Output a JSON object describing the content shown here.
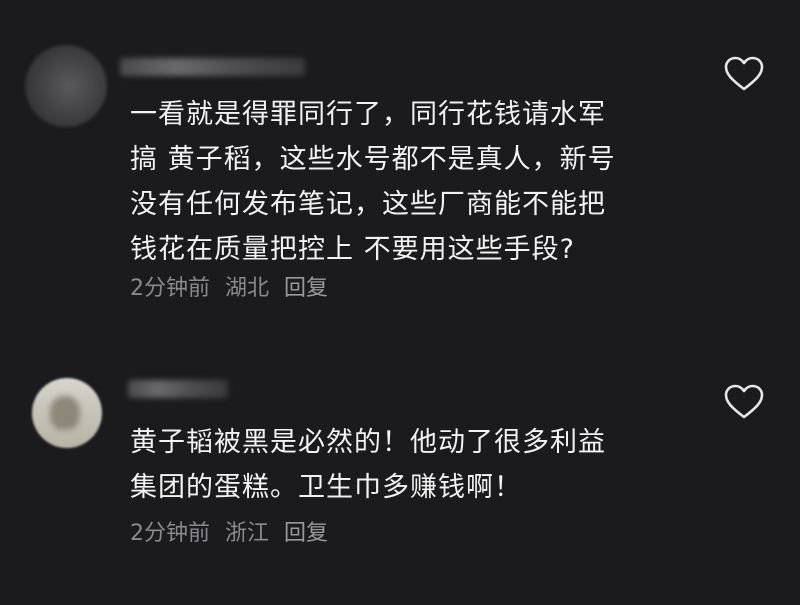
{
  "comments": [
    {
      "lines": [
        "一看就是得罪同行了，同行花钱请水军",
        "搞 黄子稻，这些水号都不是真人，新号",
        "没有任何发布笔记，这些厂商能不能把",
        "钱花在质量把控上 不要用这些手段?"
      ],
      "time": "2分钟前",
      "location": "湖北",
      "reply": "回复"
    },
    {
      "lines": [
        "黄子韬被黑是必然的！他动了很多利益",
        "集团的蛋糕。卫生巾多赚钱啊！"
      ],
      "time": "2分钟前",
      "location": "浙江",
      "reply": "回复"
    }
  ],
  "icons": {
    "like": "heart-outline-icon"
  },
  "colors": {
    "background": "#1b1b1d",
    "text": "#f2f2f2",
    "meta": "#8a8a8e"
  }
}
